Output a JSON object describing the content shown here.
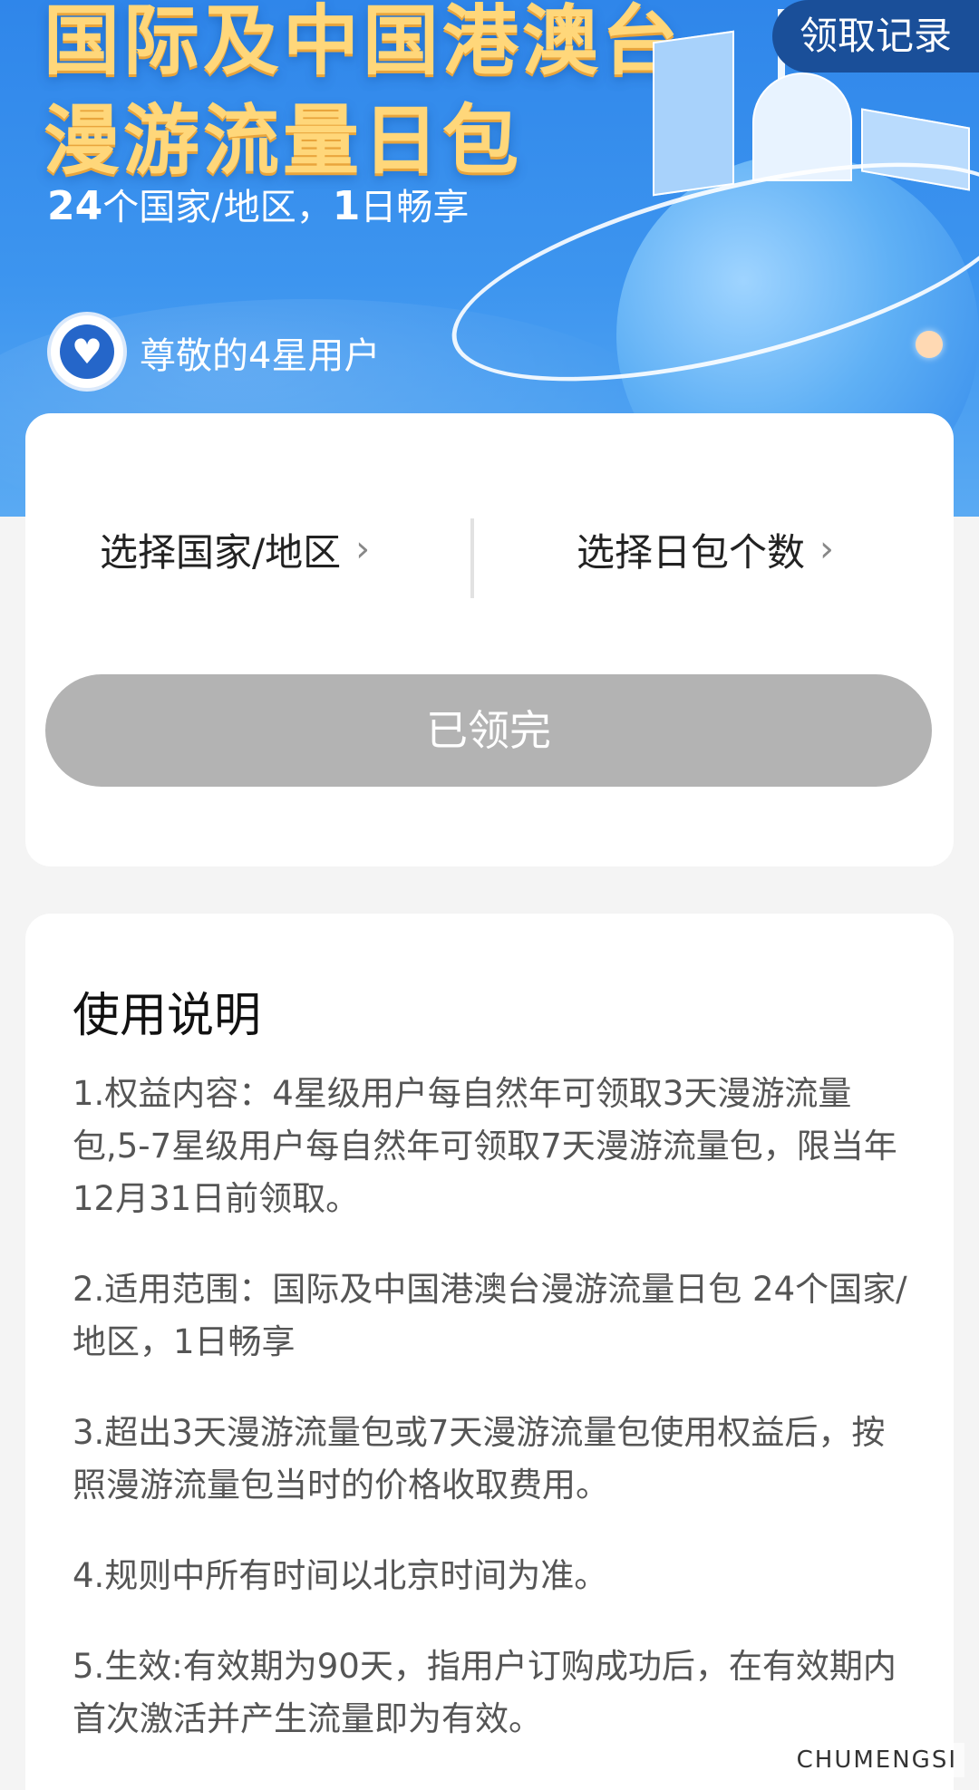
{
  "banner": {
    "title_line1": "国际及中国港澳台",
    "title_line2": "漫游流量日包",
    "subtitle_count": "24",
    "subtitle_text1": "个国家/地区，",
    "subtitle_days": "1",
    "subtitle_text2": "日畅享",
    "records_button": "领取记录",
    "user_level": "尊敬的4星用户"
  },
  "selectors": {
    "country_label": "选择国家/地区",
    "days_label": "选择日包个数",
    "chevron": "›"
  },
  "claim_button": "已领完",
  "instructions": {
    "title": "使用说明",
    "items": [
      "1.权益内容：4星级用户每自然年可领取3天漫游流量包,5-7星级用户每自然年可领取7天漫游流量包，限当年12月31日前领取。",
      "2.适用范围：国际及中国港澳台漫游流量日包 24个国家/地区，1日畅享",
      "3.超出3天漫游流量包或7天漫游流量包使用权益后，按照漫游流量包当时的价格收取费用。",
      "4.规则中所有时间以北京时间为准。",
      "5.生效:有效期为90天，指用户订购成功后，在有效期内首次激活并产生流量即为有效。"
    ]
  },
  "watermark": "CHUMENGSI",
  "colors": {
    "banner_blue": "#2f86ea",
    "title_gold": "#ffd77a",
    "records_bg": "#1a4f99",
    "button_disabled": "#b3b3b3"
  }
}
